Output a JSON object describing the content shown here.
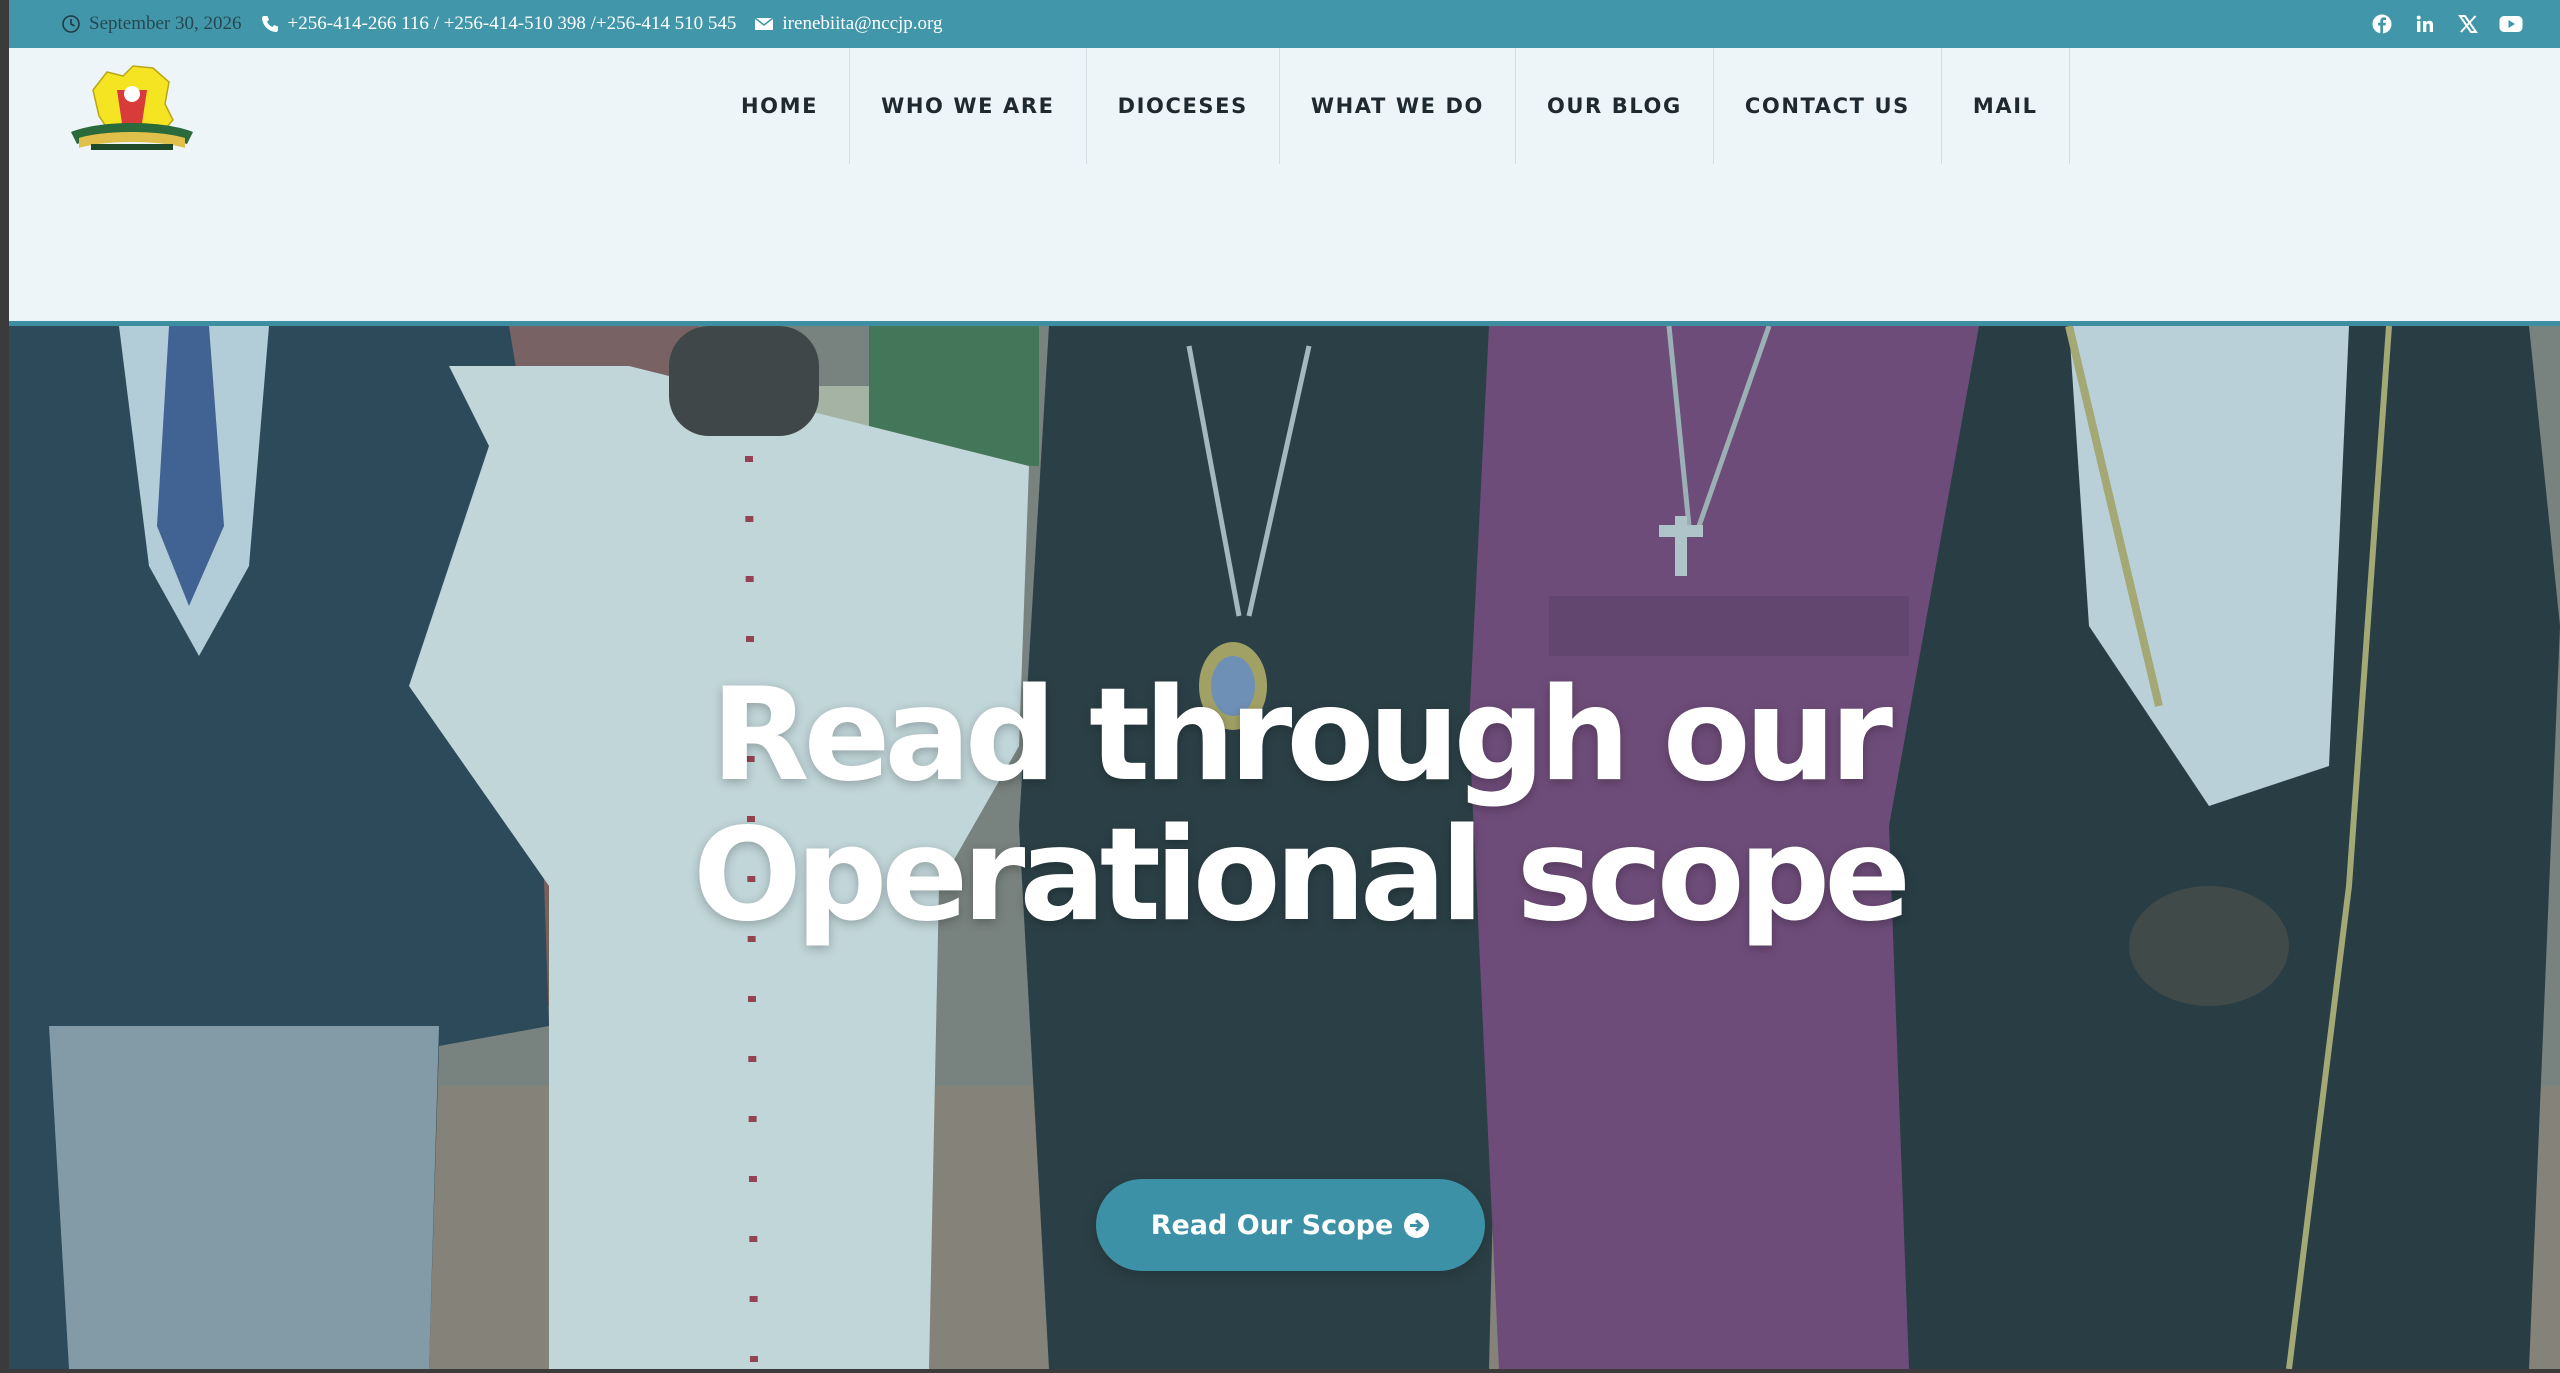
{
  "topbar": {
    "date": "September 30, 2026",
    "phone": "+256-414-266 116 / +256-414-510 398 /+256-414 510 545",
    "email": "irenebiita@nccjp.org",
    "social": [
      "facebook-icon",
      "linkedin-icon",
      "x-icon",
      "youtube-icon"
    ]
  },
  "nav": {
    "items": [
      "HOME",
      "WHO WE ARE",
      "DIOCESES",
      "WHAT WE DO",
      "OUR BLOG",
      "CONTACT US",
      "MAIL"
    ]
  },
  "hero": {
    "title_line1": "Read through our",
    "title_line2": "Operational scope",
    "button_label": "Read Our Scope"
  },
  "colors": {
    "accent": "#4197a9",
    "header_bg": "#eef5f8",
    "button": "#3d91a6"
  }
}
